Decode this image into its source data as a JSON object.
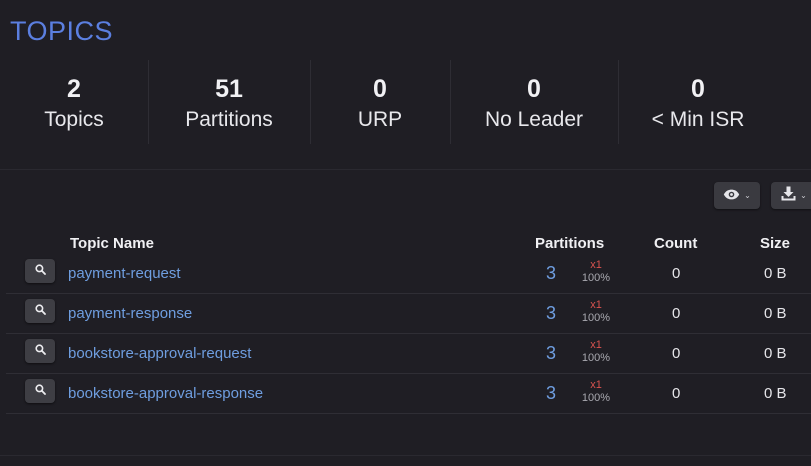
{
  "page": {
    "title": "TOPICS"
  },
  "stats": [
    {
      "value": "2",
      "label": "Topics"
    },
    {
      "value": "51",
      "label": "Partitions"
    },
    {
      "value": "0",
      "label": "URP"
    },
    {
      "value": "0",
      "label": "No Leader"
    },
    {
      "value": "0",
      "label": "< Min ISR"
    }
  ],
  "toolbar": {
    "view_icon": "eye-icon",
    "download_icon": "download-icon"
  },
  "table": {
    "columns": [
      "Topic Name",
      "Partitions",
      "Count",
      "Size"
    ],
    "rows": [
      {
        "name": "payment-request",
        "partitions": "3",
        "replication": "x1",
        "in_sync": "100%",
        "count": "0",
        "size": "0 B"
      },
      {
        "name": "payment-response",
        "partitions": "3",
        "replication": "x1",
        "in_sync": "100%",
        "count": "0",
        "size": "0 B"
      },
      {
        "name": "bookstore-approval-request",
        "partitions": "3",
        "replication": "x1",
        "in_sync": "100%",
        "count": "0",
        "size": "0 B"
      },
      {
        "name": "bookstore-approval-response",
        "partitions": "3",
        "replication": "x1",
        "in_sync": "100%",
        "count": "0",
        "size": "0 B"
      }
    ]
  },
  "colors": {
    "background": "#1f1e24",
    "title": "#5b7fe0",
    "link": "#6f9ee0",
    "replication_warn": "#d9534f"
  }
}
